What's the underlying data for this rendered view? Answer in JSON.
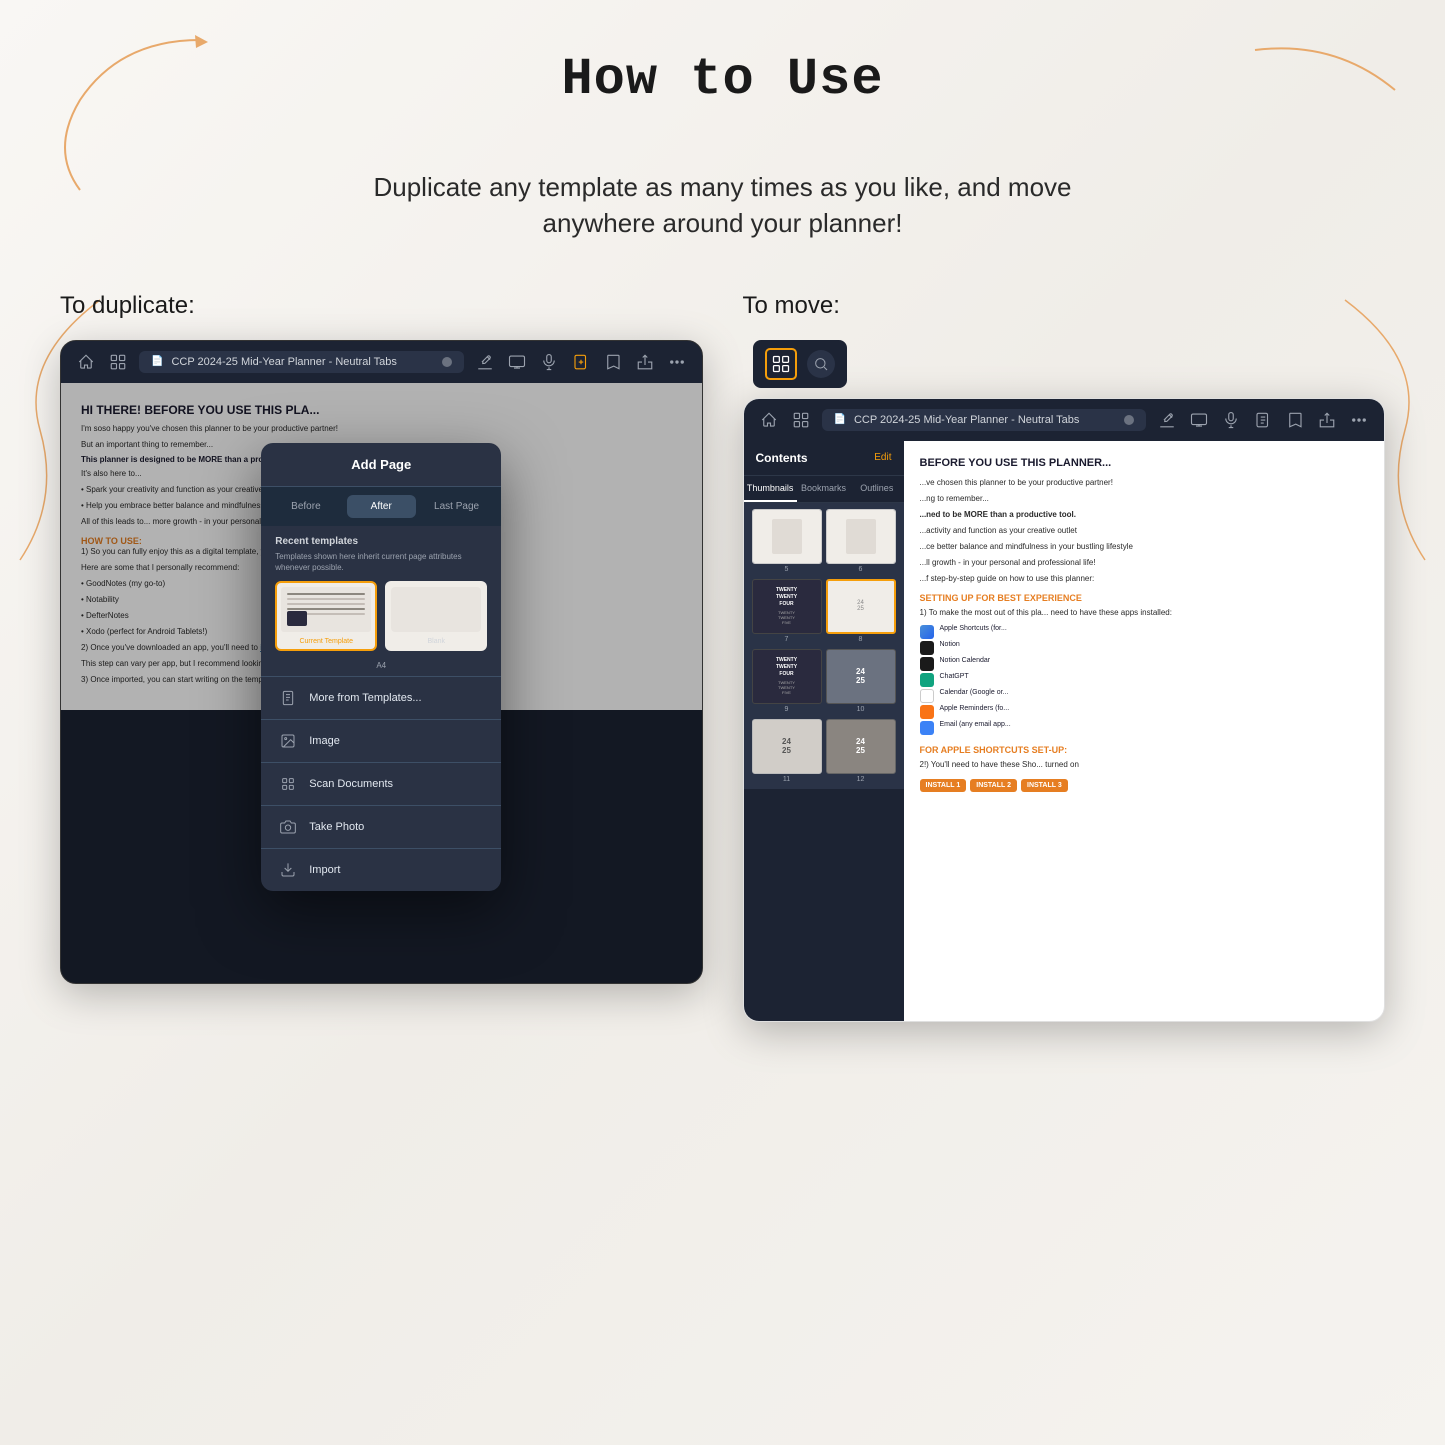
{
  "page": {
    "title": "How to Use",
    "subtitle": "Duplicate any template as many times as you like, and move anywhere around your planner!",
    "left_section": {
      "label": "To duplicate:",
      "app_bar": {
        "tab_title": "CCP 2024-25 Mid-Year Planner - Neutral Tabs",
        "close_btn": "×"
      },
      "modal": {
        "title": "Add Page",
        "tabs": [
          "Before",
          "After",
          "Last Page"
        ],
        "active_tab": "After",
        "recent_templates_label": "Recent templates",
        "recent_templates_hint": "Templates shown here inherit current page attributes whenever possible.",
        "templates": [
          {
            "label": "Current Template",
            "selected": true
          },
          {
            "label": "Blank",
            "selected": false
          }
        ],
        "template_size": "A4",
        "menu_items": [
          {
            "icon": "document-icon",
            "label": "More from Templates..."
          },
          {
            "icon": "image-icon",
            "label": "Image"
          },
          {
            "icon": "scan-icon",
            "label": "Scan Documents"
          },
          {
            "icon": "camera-icon",
            "label": "Take Photo"
          },
          {
            "icon": "import-icon",
            "label": "Import"
          }
        ]
      }
    },
    "right_section": {
      "label": "To move:",
      "app_bar": {
        "tab_title": "CCP 2024-25 Mid-Year Planner - Neutral Tabs"
      },
      "sidebar": {
        "header": "Contents",
        "edit_label": "Edit",
        "tabs": [
          "Thumbnails",
          "Bookmarks",
          "Outlines"
        ],
        "active_tab": "Thumbnails",
        "thumbnails": [
          {
            "num": "5",
            "type": "light",
            "selected": false
          },
          {
            "num": "6",
            "type": "light",
            "selected": false
          },
          {
            "num": "7",
            "type": "dark",
            "text": "TWENTY\nTWENTY\nFOUR",
            "selected": false
          },
          {
            "num": "8",
            "type": "selected_box",
            "selected": true
          },
          {
            "num": "9",
            "type": "dark2",
            "text": "TWENTY\nTWENTY\nFOUR",
            "selected": false
          },
          {
            "num": "10",
            "type": "gray",
            "text": "24\n25",
            "selected": false
          },
          {
            "num": "11",
            "type": "light2",
            "text": "24\n25",
            "selected": false
          },
          {
            "num": "12",
            "type": "gray2",
            "text": "24\n25",
            "selected": false
          }
        ]
      },
      "main_content": {
        "title": "BEFORE YOU USE THIS PLANNER...",
        "orange_section": "SETTING UP FOR BEST EXPERIENCE",
        "apps": [
          "Apple Shortcuts (for...",
          "Notion",
          "Notion Calendar",
          "ChatGPT",
          "Calendar (Google or...",
          "Apple Reminders (fo...",
          "Email (any email app..."
        ],
        "shortcuts_section": "FOR APPLE SHORTCUTS SET-UP:",
        "install_buttons": [
          "INSTALL 1",
          "INSTALL 2",
          "INSTALL 3"
        ]
      }
    }
  }
}
